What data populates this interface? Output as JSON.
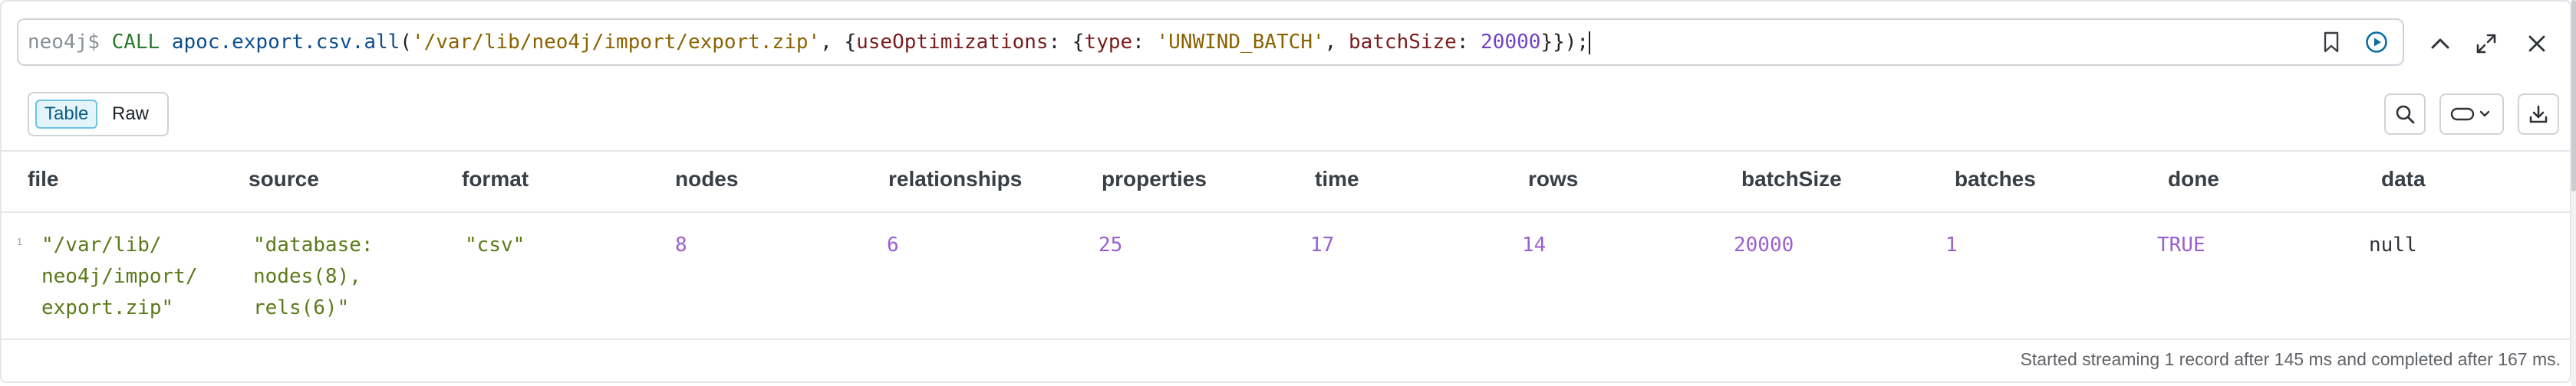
{
  "editor": {
    "prompt": "neo4j$",
    "query_tokens": [
      {
        "t": "CALL",
        "c": "kw"
      },
      {
        "t": " ",
        "c": "plain"
      },
      {
        "t": "apoc.export.csv.all",
        "c": "fn"
      },
      {
        "t": "(",
        "c": "plain"
      },
      {
        "t": "'/var/lib/neo4j/import/export.zip'",
        "c": "str"
      },
      {
        "t": ", {",
        "c": "plain"
      },
      {
        "t": "useOptimizations",
        "c": "key"
      },
      {
        "t": ": {",
        "c": "plain"
      },
      {
        "t": "type",
        "c": "key"
      },
      {
        "t": ": ",
        "c": "plain"
      },
      {
        "t": "'UNWIND_BATCH'",
        "c": "str"
      },
      {
        "t": ", ",
        "c": "plain"
      },
      {
        "t": "batchSize",
        "c": "key"
      },
      {
        "t": ": ",
        "c": "plain"
      },
      {
        "t": "20000",
        "c": "num"
      },
      {
        "t": "}});",
        "c": "plain"
      }
    ]
  },
  "view_toggle": {
    "table_label": "Table",
    "raw_label": "Raw",
    "selected": "Table"
  },
  "icons": {
    "bookmark": "bookmark-icon",
    "run": "play-circle-icon",
    "collapse": "chevron-up-icon",
    "fullscreen": "expand-icon",
    "close": "close-icon",
    "search": "search-icon",
    "theme": "pill-dropdown-icon",
    "download": "download-icon"
  },
  "table": {
    "columns": [
      "file",
      "source",
      "format",
      "nodes",
      "relationships",
      "properties",
      "time",
      "rows",
      "batchSize",
      "batches",
      "done",
      "data"
    ],
    "row_number": "1",
    "row": {
      "file": "\"/var/lib/\nneo4j/import/\nexport.zip\"",
      "source": "\"database:\nnodes(8),\nrels(6)\"",
      "format": "\"csv\"",
      "nodes": "8",
      "relationships": "6",
      "properties": "25",
      "time": "17",
      "rows": "14",
      "batchSize": "20000",
      "batches": "1",
      "done": "TRUE",
      "data": "null"
    }
  },
  "status": "Started streaming 1 record after 145 ms and completed after 167 ms."
}
